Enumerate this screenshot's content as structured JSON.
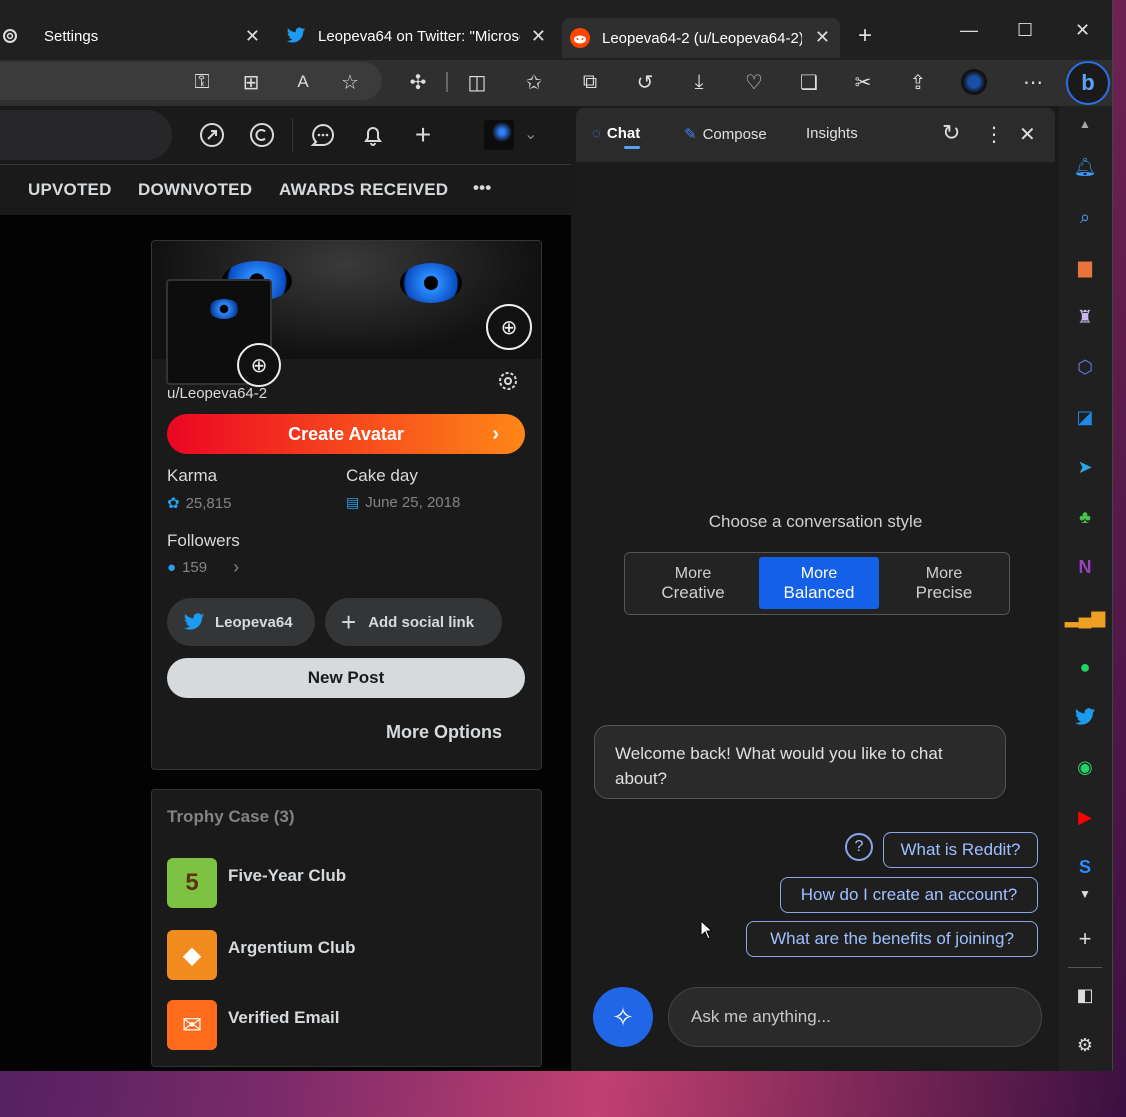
{
  "browser": {
    "tabs": [
      {
        "title": "Settings",
        "icon": "gear-icon"
      },
      {
        "title": "Leopeva64 on Twitter: \"Microsc",
        "icon": "twitter-icon"
      },
      {
        "title": "Leopeva64-2 (u/Leopeva64-2)",
        "icon": "reddit-icon"
      }
    ],
    "new_tab": "+",
    "window_controls": {
      "minimize": "—",
      "maximize": "☐",
      "close": "✕"
    }
  },
  "reddit": {
    "nav_tabs": [
      "UPVOTED",
      "DOWNVOTED",
      "AWARDS RECEIVED",
      "•••"
    ],
    "profile": {
      "username": "u/Leopeva64-2",
      "create_avatar": "Create Avatar",
      "karma_label": "Karma",
      "karma_value": "25,815",
      "cakeday_label": "Cake day",
      "cakeday_value": "June 25, 2018",
      "followers_label": "Followers",
      "followers_value": "159",
      "social_link": "Leopeva64",
      "add_social": "Add social link",
      "new_post": "New Post",
      "more_options": "More Options"
    },
    "trophy": {
      "title": "Trophy Case (3)",
      "items": [
        {
          "name": "Five-Year Club",
          "color": "#7dc242"
        },
        {
          "name": "Argentium Club",
          "color": "#f28b1e"
        },
        {
          "name": "Verified Email",
          "color": "#ff6b1a"
        }
      ]
    }
  },
  "copilot": {
    "tabs": [
      "Chat",
      "Compose",
      "Insights"
    ],
    "choose_label": "Choose a conversation style",
    "styles": [
      {
        "line1": "More",
        "line2": "Creative"
      },
      {
        "line1": "More",
        "line2": "Balanced"
      },
      {
        "line1": "More",
        "line2": "Precise"
      }
    ],
    "selected_style": "Balanced",
    "welcome": "Welcome back! What would you like to chat about?",
    "suggestions": [
      "What is Reddit?",
      "How do I create an account?",
      "What are the benefits of joining?"
    ],
    "input_placeholder": "Ask me anything...",
    "accent": "#1460e8"
  }
}
